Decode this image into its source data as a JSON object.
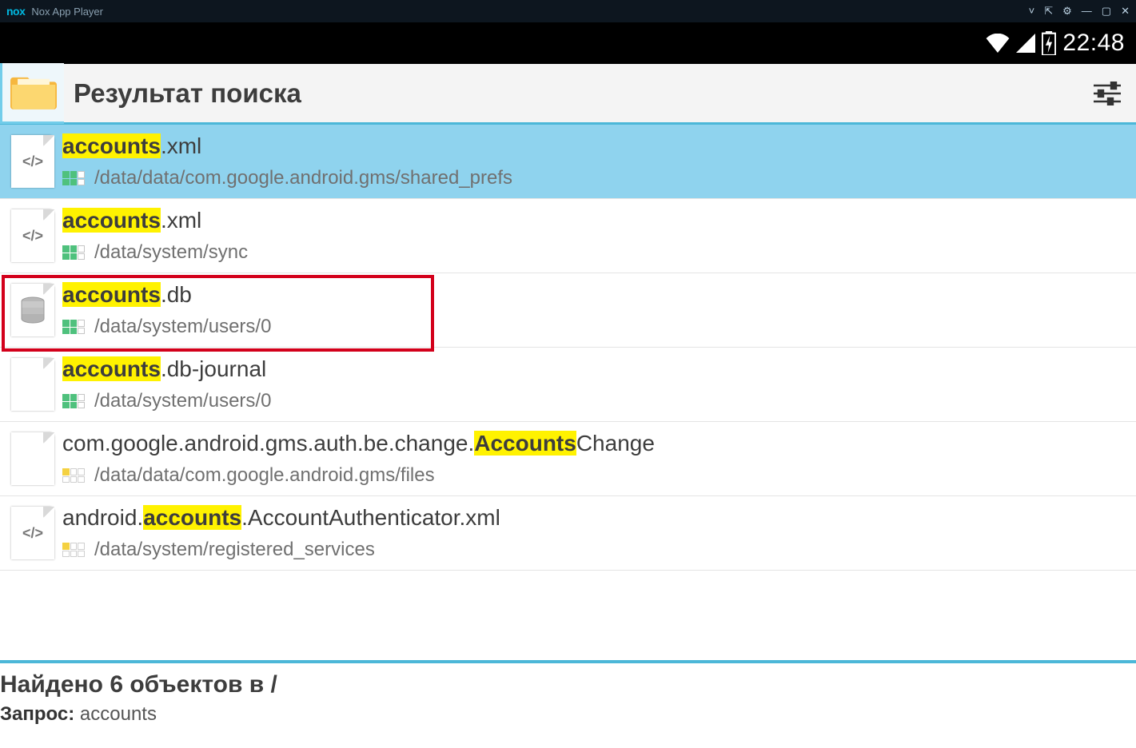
{
  "window": {
    "title": "Nox App Player",
    "logo": "nox"
  },
  "android_status": {
    "time": "22:48"
  },
  "app_header": {
    "title": "Результат поиска"
  },
  "results": [
    {
      "name_pre": "",
      "name_hl": "accounts",
      "name_post": ".xml",
      "path": "/data/data/com.google.android.gms/shared_prefs",
      "icon": "code",
      "perm": "green",
      "selected": true,
      "annot": false
    },
    {
      "name_pre": "",
      "name_hl": "accounts",
      "name_post": ".xml",
      "path": "/data/system/sync",
      "icon": "code",
      "perm": "green",
      "selected": false,
      "annot": false
    },
    {
      "name_pre": "",
      "name_hl": "accounts",
      "name_post": ".db",
      "path": "/data/system/users/0",
      "icon": "db",
      "perm": "green",
      "selected": false,
      "annot": true
    },
    {
      "name_pre": "",
      "name_hl": "accounts",
      "name_post": ".db-journal",
      "path": "/data/system/users/0",
      "icon": "blank",
      "perm": "green",
      "selected": false,
      "annot": false
    },
    {
      "name_pre": "com.google.android.gms.auth.be.change.",
      "name_hl": "Accounts",
      "name_post": "Change",
      "path": "/data/data/com.google.android.gms/files",
      "icon": "blank",
      "perm": "yellow",
      "selected": false,
      "annot": false
    },
    {
      "name_pre": "android.",
      "name_hl": "accounts",
      "name_post": ".AccountAuthenticator.xml",
      "path": "/data/system/registered_services",
      "icon": "code",
      "perm": "yellow",
      "selected": false,
      "annot": false
    }
  ],
  "footer": {
    "found_label_pre": "Найдено ",
    "found_count": "6",
    "found_label_post": " объектов в /",
    "query_label": "Запрос:",
    "query_value": "accounts"
  }
}
